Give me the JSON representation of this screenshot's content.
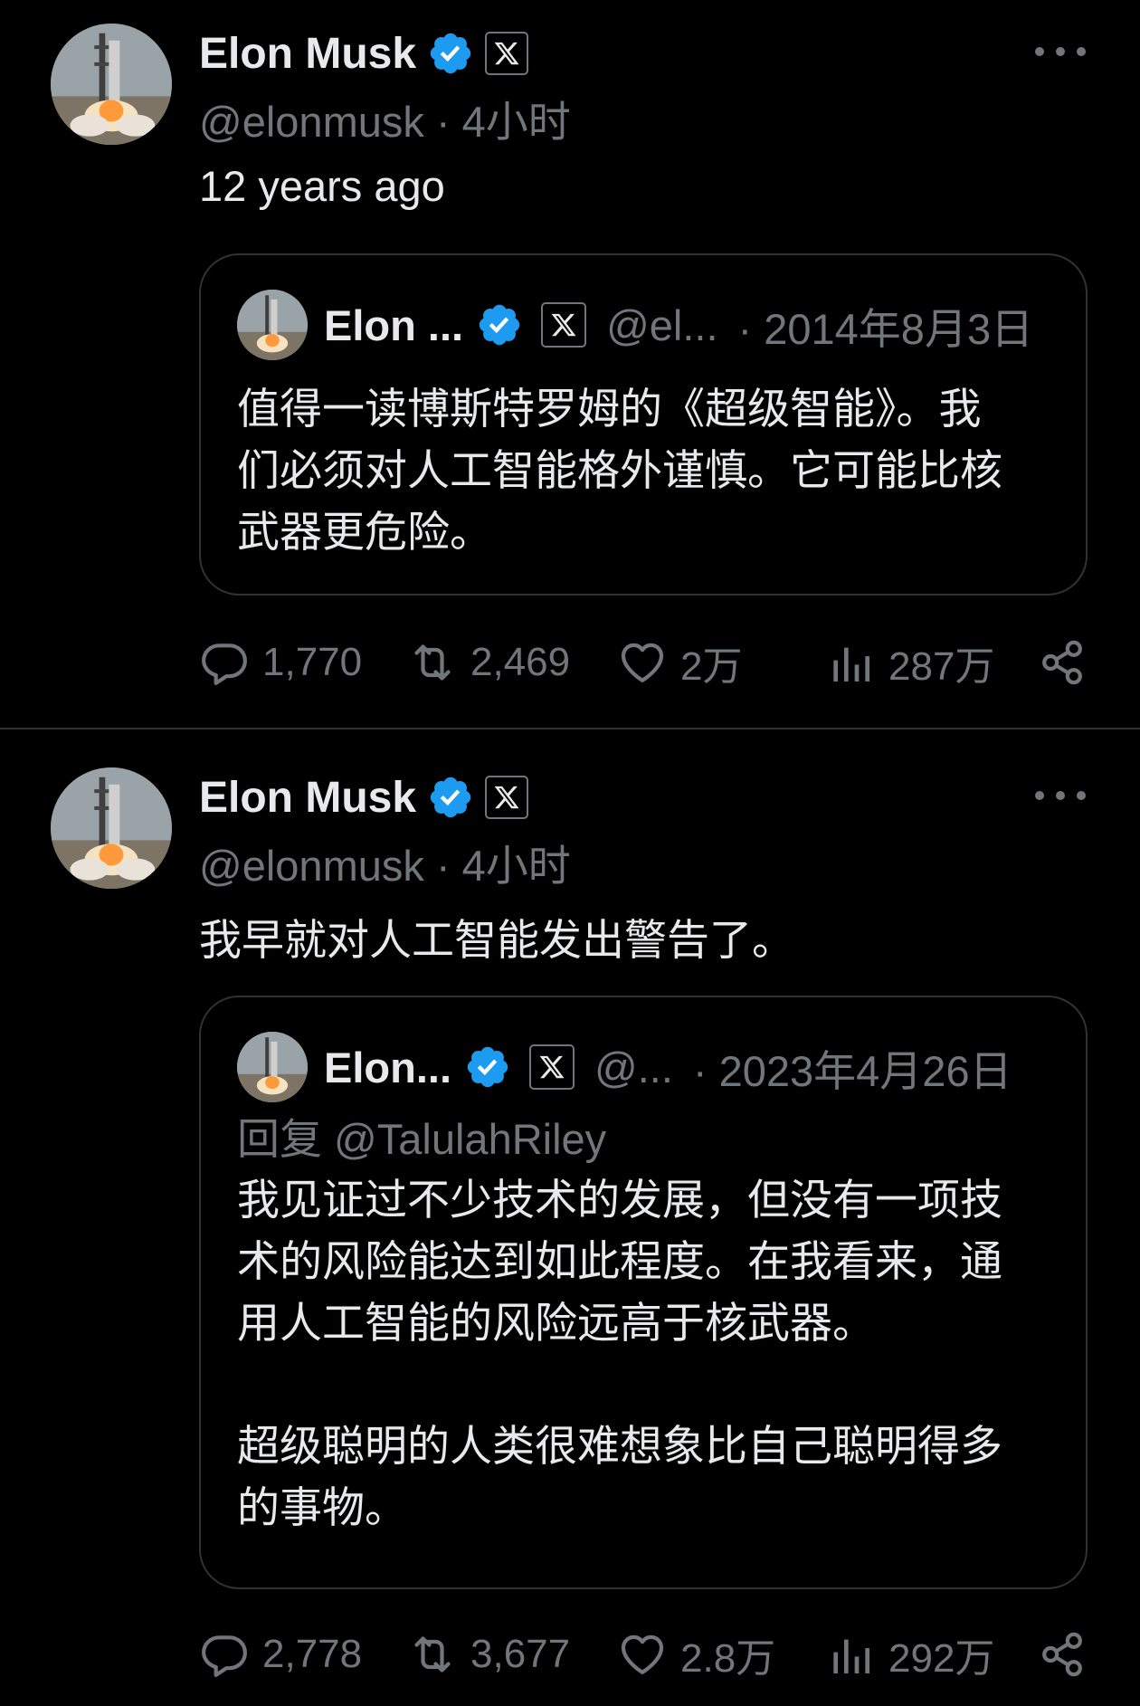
{
  "colors": {
    "background": "#000000",
    "text_primary": "#e7e9ea",
    "text_secondary": "#71767b",
    "verified_blue": "#1d9bf0",
    "border": "#2f3336"
  },
  "tweets": [
    {
      "author": {
        "name": "Elon Musk",
        "handle": "@elonmusk",
        "separator": "·",
        "time": "4小时"
      },
      "badges": [
        "verified-check-icon",
        "x-affiliation-icon"
      ],
      "text": "12 years ago",
      "quote": {
        "author_name": "Elon ...",
        "handle": "@el...",
        "separator": "·",
        "date": "2014年8月3日",
        "replying_to": "",
        "body": [
          "值得一读博斯特罗姆的《超级智能》。我",
          "们必须对人工智能格外谨慎。它可能比核",
          "武器更危险。"
        ]
      },
      "stats": {
        "replies": "1,770",
        "reposts": "2,469",
        "likes": "2万",
        "views": "287万"
      }
    },
    {
      "author": {
        "name": "Elon Musk",
        "handle": "@elonmusk",
        "separator": "·",
        "time": "4小时"
      },
      "badges": [
        "verified-check-icon",
        "x-affiliation-icon"
      ],
      "text": "我早就对人工智能发出警告了。",
      "quote": {
        "author_name": "Elon...",
        "handle": "@...",
        "separator": "·",
        "date": "2023年4月26日",
        "replying_to": "回复 @TalulahRiley",
        "body": [
          "我见证过不少技术的发展，但没有一项技",
          "术的风险能达到如此程度。在我看来，通",
          "用人工智能的风险远高于核武器。",
          "",
          "超级聪明的人类很难想象比自己聪明得多",
          "的事物。"
        ]
      },
      "stats": {
        "replies": "2,778",
        "reposts": "3,677",
        "likes": "2.8万",
        "views": "292万"
      }
    }
  ]
}
